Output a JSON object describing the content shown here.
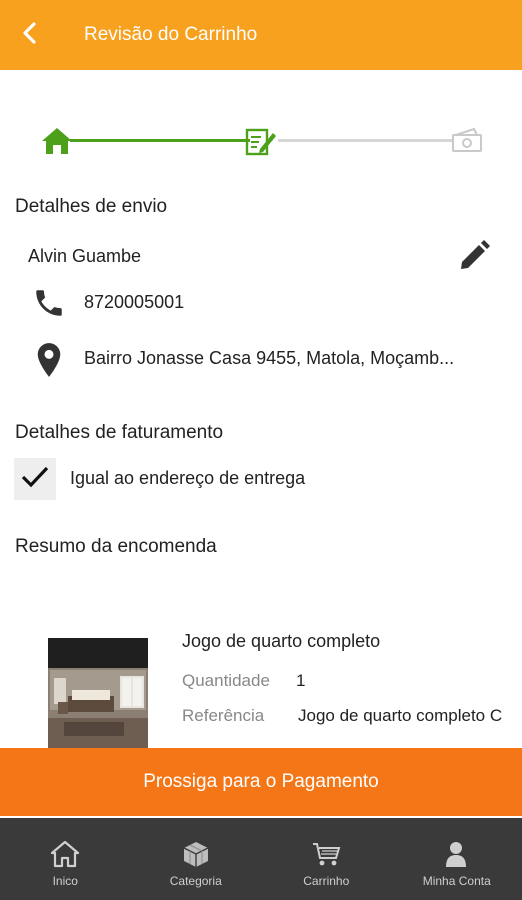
{
  "header": {
    "title": "Revisão do Carrinho",
    "back_icon": "chevron-left-icon"
  },
  "stepper": {
    "steps": [
      {
        "icon": "home-icon",
        "state": "done"
      },
      {
        "icon": "edit-form-icon",
        "state": "current"
      },
      {
        "icon": "money-icon",
        "state": "pending"
      }
    ],
    "active_color": "#4da01a",
    "inactive_color": "#d6d6d6"
  },
  "shipping": {
    "title": "Detalhes de envio",
    "name": "Alvin Guambe",
    "phone": "8720005001",
    "address": "Bairro Jonasse Casa 9455, Matola, Moçamb..."
  },
  "billing": {
    "title": "Detalhes de faturamento",
    "same_as_shipping_label": "Igual ao endereço de entrega",
    "same_as_shipping_checked": true
  },
  "summary": {
    "title": "Resumo da encomenda",
    "items": [
      {
        "name": "Jogo de quarto completo",
        "quantity_label": "Quantidade",
        "quantity": "1",
        "reference_label": "Referência",
        "reference": "Jogo de quarto completo C"
      }
    ]
  },
  "actions": {
    "pay_label": "Prossiga para o Pagamento"
  },
  "bottom_nav": {
    "items": [
      {
        "label": "Inico",
        "icon": "home-icon"
      },
      {
        "label": "Categoria",
        "icon": "category-cube-icon"
      },
      {
        "label": "Carrinho",
        "icon": "cart-icon"
      },
      {
        "label": "Minha Conta",
        "icon": "user-icon"
      }
    ]
  },
  "colors": {
    "header": "#f7a11f",
    "button": "#f57617",
    "nav": "#3a3a3a"
  }
}
